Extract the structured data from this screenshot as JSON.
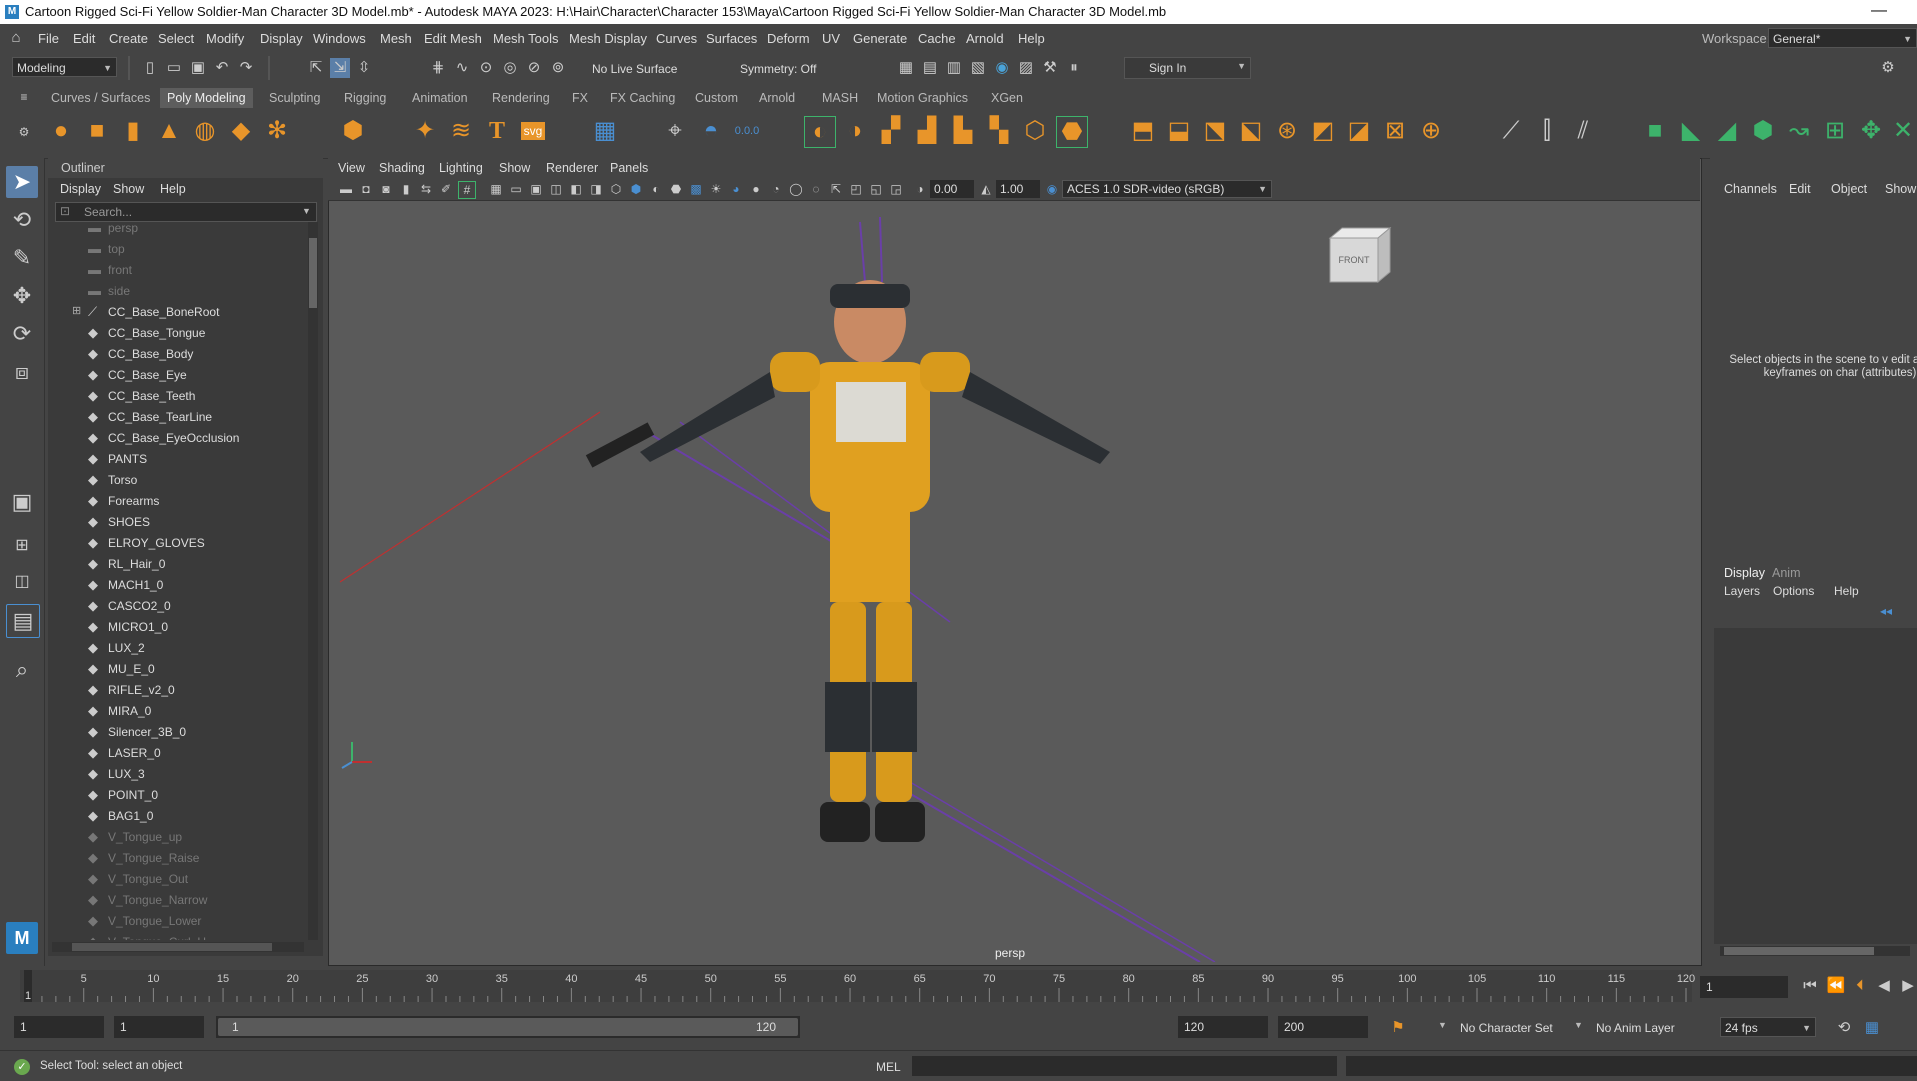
{
  "window": {
    "title": "Cartoon Rigged Sci-Fi Yellow Soldier-Man Character 3D Model.mb* - Autodesk MAYA 2023: H:\\Hair\\Character\\Character 153\\Maya\\Cartoon Rigged Sci-Fi Yellow Soldier-Man Character 3D Model.mb",
    "min_glyph": "—"
  },
  "menubar": {
    "items": [
      "File",
      "Edit",
      "Create",
      "Select",
      "Modify",
      "Display",
      "Windows",
      "Mesh",
      "Edit Mesh",
      "Mesh Tools",
      "Mesh Display",
      "Curves",
      "Surfaces",
      "Deform",
      "UV",
      "Generate",
      "Cache",
      "Arnold",
      "Help"
    ],
    "workspace_label": "Workspace:",
    "workspace_value": "General*"
  },
  "statusline": {
    "mode": "Modeling",
    "live_surface": "No Live Surface",
    "symmetry": "Symmetry: Off",
    "sign_in": "Sign In"
  },
  "shelf": {
    "tabs": [
      "Curves / Surfaces",
      "Poly Modeling",
      "Sculpting",
      "Rigging",
      "Animation",
      "Rendering",
      "FX",
      "FX Caching",
      "Custom",
      "Arnold",
      "MASH",
      "Motion Graphics",
      "XGen"
    ],
    "active_tab": "Poly Modeling",
    "svg_label": "svg",
    "text_icon": "T",
    "value_label": "0.0.0"
  },
  "outliner": {
    "title": "Outliner",
    "menus": [
      "Display",
      "Show",
      "Help"
    ],
    "search_placeholder": "Search...",
    "items": [
      {
        "label": "persp",
        "icon": "camera-icon",
        "dim": true
      },
      {
        "label": "top",
        "icon": "camera-icon",
        "dim": true
      },
      {
        "label": "front",
        "icon": "camera-icon",
        "dim": true
      },
      {
        "label": "side",
        "icon": "camera-icon",
        "dim": true
      },
      {
        "label": "CC_Base_BoneRoot",
        "icon": "joint-icon",
        "dim": false,
        "expand": true
      },
      {
        "label": "CC_Base_Tongue",
        "icon": "mesh-icon",
        "dim": false
      },
      {
        "label": "CC_Base_Body",
        "icon": "mesh-icon",
        "dim": false
      },
      {
        "label": "CC_Base_Eye",
        "icon": "mesh-icon",
        "dim": false
      },
      {
        "label": "CC_Base_Teeth",
        "icon": "mesh-icon",
        "dim": false
      },
      {
        "label": "CC_Base_TearLine",
        "icon": "mesh-icon",
        "dim": false
      },
      {
        "label": "CC_Base_EyeOcclusion",
        "icon": "mesh-icon",
        "dim": false
      },
      {
        "label": "PANTS",
        "icon": "mesh-icon",
        "dim": false
      },
      {
        "label": "Torso",
        "icon": "mesh-icon",
        "dim": false
      },
      {
        "label": "Forearms",
        "icon": "mesh-icon",
        "dim": false
      },
      {
        "label": "SHOES",
        "icon": "mesh-icon",
        "dim": false
      },
      {
        "label": "ELROY_GLOVES",
        "icon": "mesh-icon",
        "dim": false
      },
      {
        "label": "RL_Hair_0",
        "icon": "mesh-icon",
        "dim": false
      },
      {
        "label": "MACH1_0",
        "icon": "mesh-icon",
        "dim": false
      },
      {
        "label": "CASCO2_0",
        "icon": "mesh-icon",
        "dim": false
      },
      {
        "label": "MICRO1_0",
        "icon": "mesh-icon",
        "dim": false
      },
      {
        "label": "LUX_2",
        "icon": "mesh-icon",
        "dim": false
      },
      {
        "label": "MU_E_0",
        "icon": "mesh-icon",
        "dim": false
      },
      {
        "label": "RIFLE_v2_0",
        "icon": "mesh-icon",
        "dim": false
      },
      {
        "label": "MIRA_0",
        "icon": "mesh-icon",
        "dim": false
      },
      {
        "label": "Silencer_3B_0",
        "icon": "mesh-icon",
        "dim": false
      },
      {
        "label": "LASER_0",
        "icon": "mesh-icon",
        "dim": false
      },
      {
        "label": "LUX_3",
        "icon": "mesh-icon",
        "dim": false
      },
      {
        "label": "POINT_0",
        "icon": "mesh-icon",
        "dim": false
      },
      {
        "label": "BAG1_0",
        "icon": "mesh-icon",
        "dim": false
      },
      {
        "label": "V_Tongue_up",
        "icon": "mesh-icon",
        "dim": true
      },
      {
        "label": "V_Tongue_Raise",
        "icon": "mesh-icon",
        "dim": true
      },
      {
        "label": "V_Tongue_Out",
        "icon": "mesh-icon",
        "dim": true
      },
      {
        "label": "V_Tongue_Narrow",
        "icon": "mesh-icon",
        "dim": true
      },
      {
        "label": "V_Tongue_Lower",
        "icon": "mesh-icon",
        "dim": true
      },
      {
        "label": "V_Tongue_Curl_U",
        "icon": "mesh-icon",
        "dim": true
      }
    ]
  },
  "viewport": {
    "menus": [
      "View",
      "Shading",
      "Lighting",
      "Show",
      "Renderer",
      "Panels"
    ],
    "exposure": "0.00",
    "gamma": "1.00",
    "color_space": "ACES 1.0 SDR-video (sRGB)",
    "camera_label": "persp",
    "viewcube_label": "FRONT"
  },
  "channelbox": {
    "menus": [
      "Channels",
      "Edit",
      "Object",
      "Show"
    ],
    "message": "Select objects in the scene to v edit and set keyframes on char (attributes)"
  },
  "layers": {
    "tabs": [
      "Display",
      "Anim"
    ],
    "active_tab": "Display",
    "menus": [
      "Layers",
      "Options",
      "Help"
    ]
  },
  "timeline": {
    "ticks": [
      "5",
      "10",
      "15",
      "20",
      "25",
      "30",
      "35",
      "40",
      "45",
      "50",
      "55",
      "60",
      "65",
      "70",
      "75",
      "80",
      "85",
      "90",
      "95",
      "100",
      "105",
      "110",
      "115",
      "120"
    ],
    "current_frame": "1",
    "current_frame_field": "1"
  },
  "range": {
    "start": "1",
    "playback_start": "1",
    "slider_start": "1",
    "slider_end": "120",
    "playback_end": "120",
    "end": "200",
    "character_set": "No Character Set",
    "anim_layer": "No Anim Layer",
    "fps": "24 fps"
  },
  "helpline": {
    "message": "Select Tool: select an object",
    "mel_label": "MEL"
  },
  "colors": {
    "accent_blue": "#4a8fd1",
    "shelf_orange": "#e8952a",
    "shelf_green": "#3db36b",
    "character_yellow": "#e0a020"
  }
}
